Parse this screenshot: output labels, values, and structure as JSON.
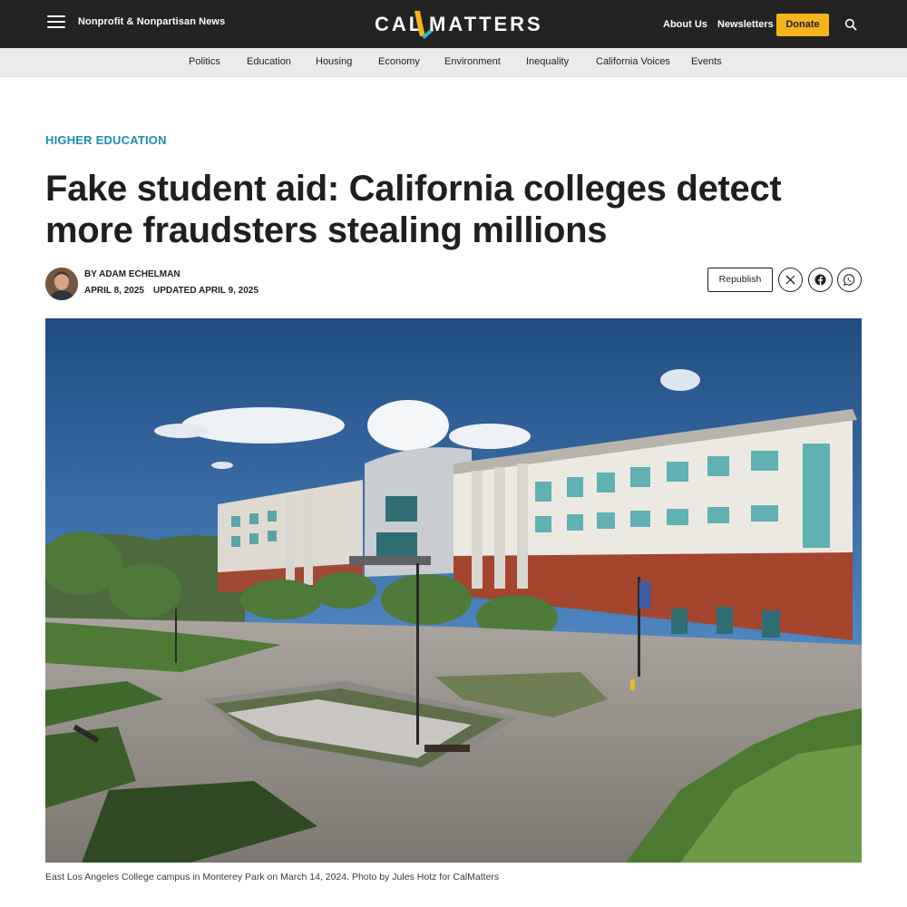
{
  "header": {
    "tagline": "Nonprofit & Nonpartisan News",
    "logo_left": "CAL",
    "logo_right": "MATTERS",
    "about_label": "About Us",
    "newsletters_label": "Newsletters",
    "donate_label": "Donate"
  },
  "sections": [
    {
      "label": "Politics"
    },
    {
      "label": "Education"
    },
    {
      "label": "Housing"
    },
    {
      "label": "Economy"
    },
    {
      "label": "Environment"
    },
    {
      "label": "Inequality"
    },
    {
      "label": "California Voices"
    },
    {
      "label": "Events"
    }
  ],
  "article": {
    "kicker": "HIGHER EDUCATION",
    "headline": "Fake student aid: California colleges detect more fraudsters stealing millions",
    "byline": "BY ADAM ECHELMAN",
    "date": "APRIL 8, 2025",
    "updated": "UPDATED APRIL 9, 2025",
    "republish_label": "Republish",
    "share_icons": [
      "x-icon",
      "facebook-icon",
      "whatsapp-icon"
    ],
    "hero_caption": "East Los Angeles College campus in Monterey Park on March 14, 2024. Photo by Jules Hotz for CalMatters"
  },
  "colors": {
    "topbar": "#232323",
    "accent_blue": "#1a8fb3",
    "donate_yellow": "#f5b419",
    "section_nav": "#ebebeb"
  }
}
